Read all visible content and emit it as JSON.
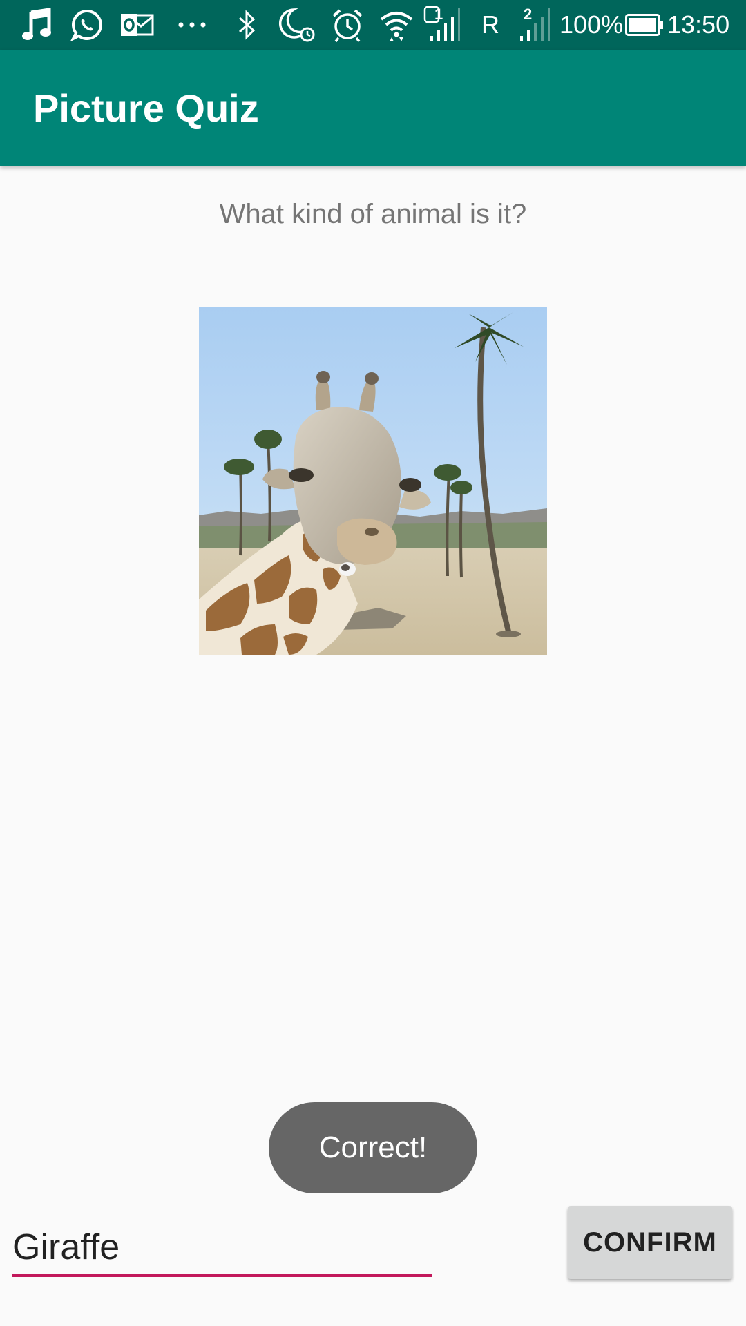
{
  "status_bar": {
    "battery": "100%",
    "time": "13:50",
    "roaming": "R",
    "sim1": "1",
    "sim2": "2",
    "icons": [
      "music-icon",
      "whatsapp-icon",
      "outlook-icon",
      "more-dots-icon",
      "bluetooth-icon",
      "do-not-disturb-moon-icon",
      "alarm-icon",
      "wifi-icon",
      "signal-icon",
      "battery-icon"
    ],
    "color": "#00665b"
  },
  "app_bar": {
    "title": "Picture Quiz",
    "color": "#008577"
  },
  "quiz": {
    "question": "What kind of animal is it?",
    "picture_subject": "giraffe-photo"
  },
  "toast": {
    "message": "Correct!"
  },
  "answer": {
    "value": "Giraffe",
    "underline_color": "#c2185b"
  },
  "confirm_button": {
    "label": "CONFIRM"
  }
}
